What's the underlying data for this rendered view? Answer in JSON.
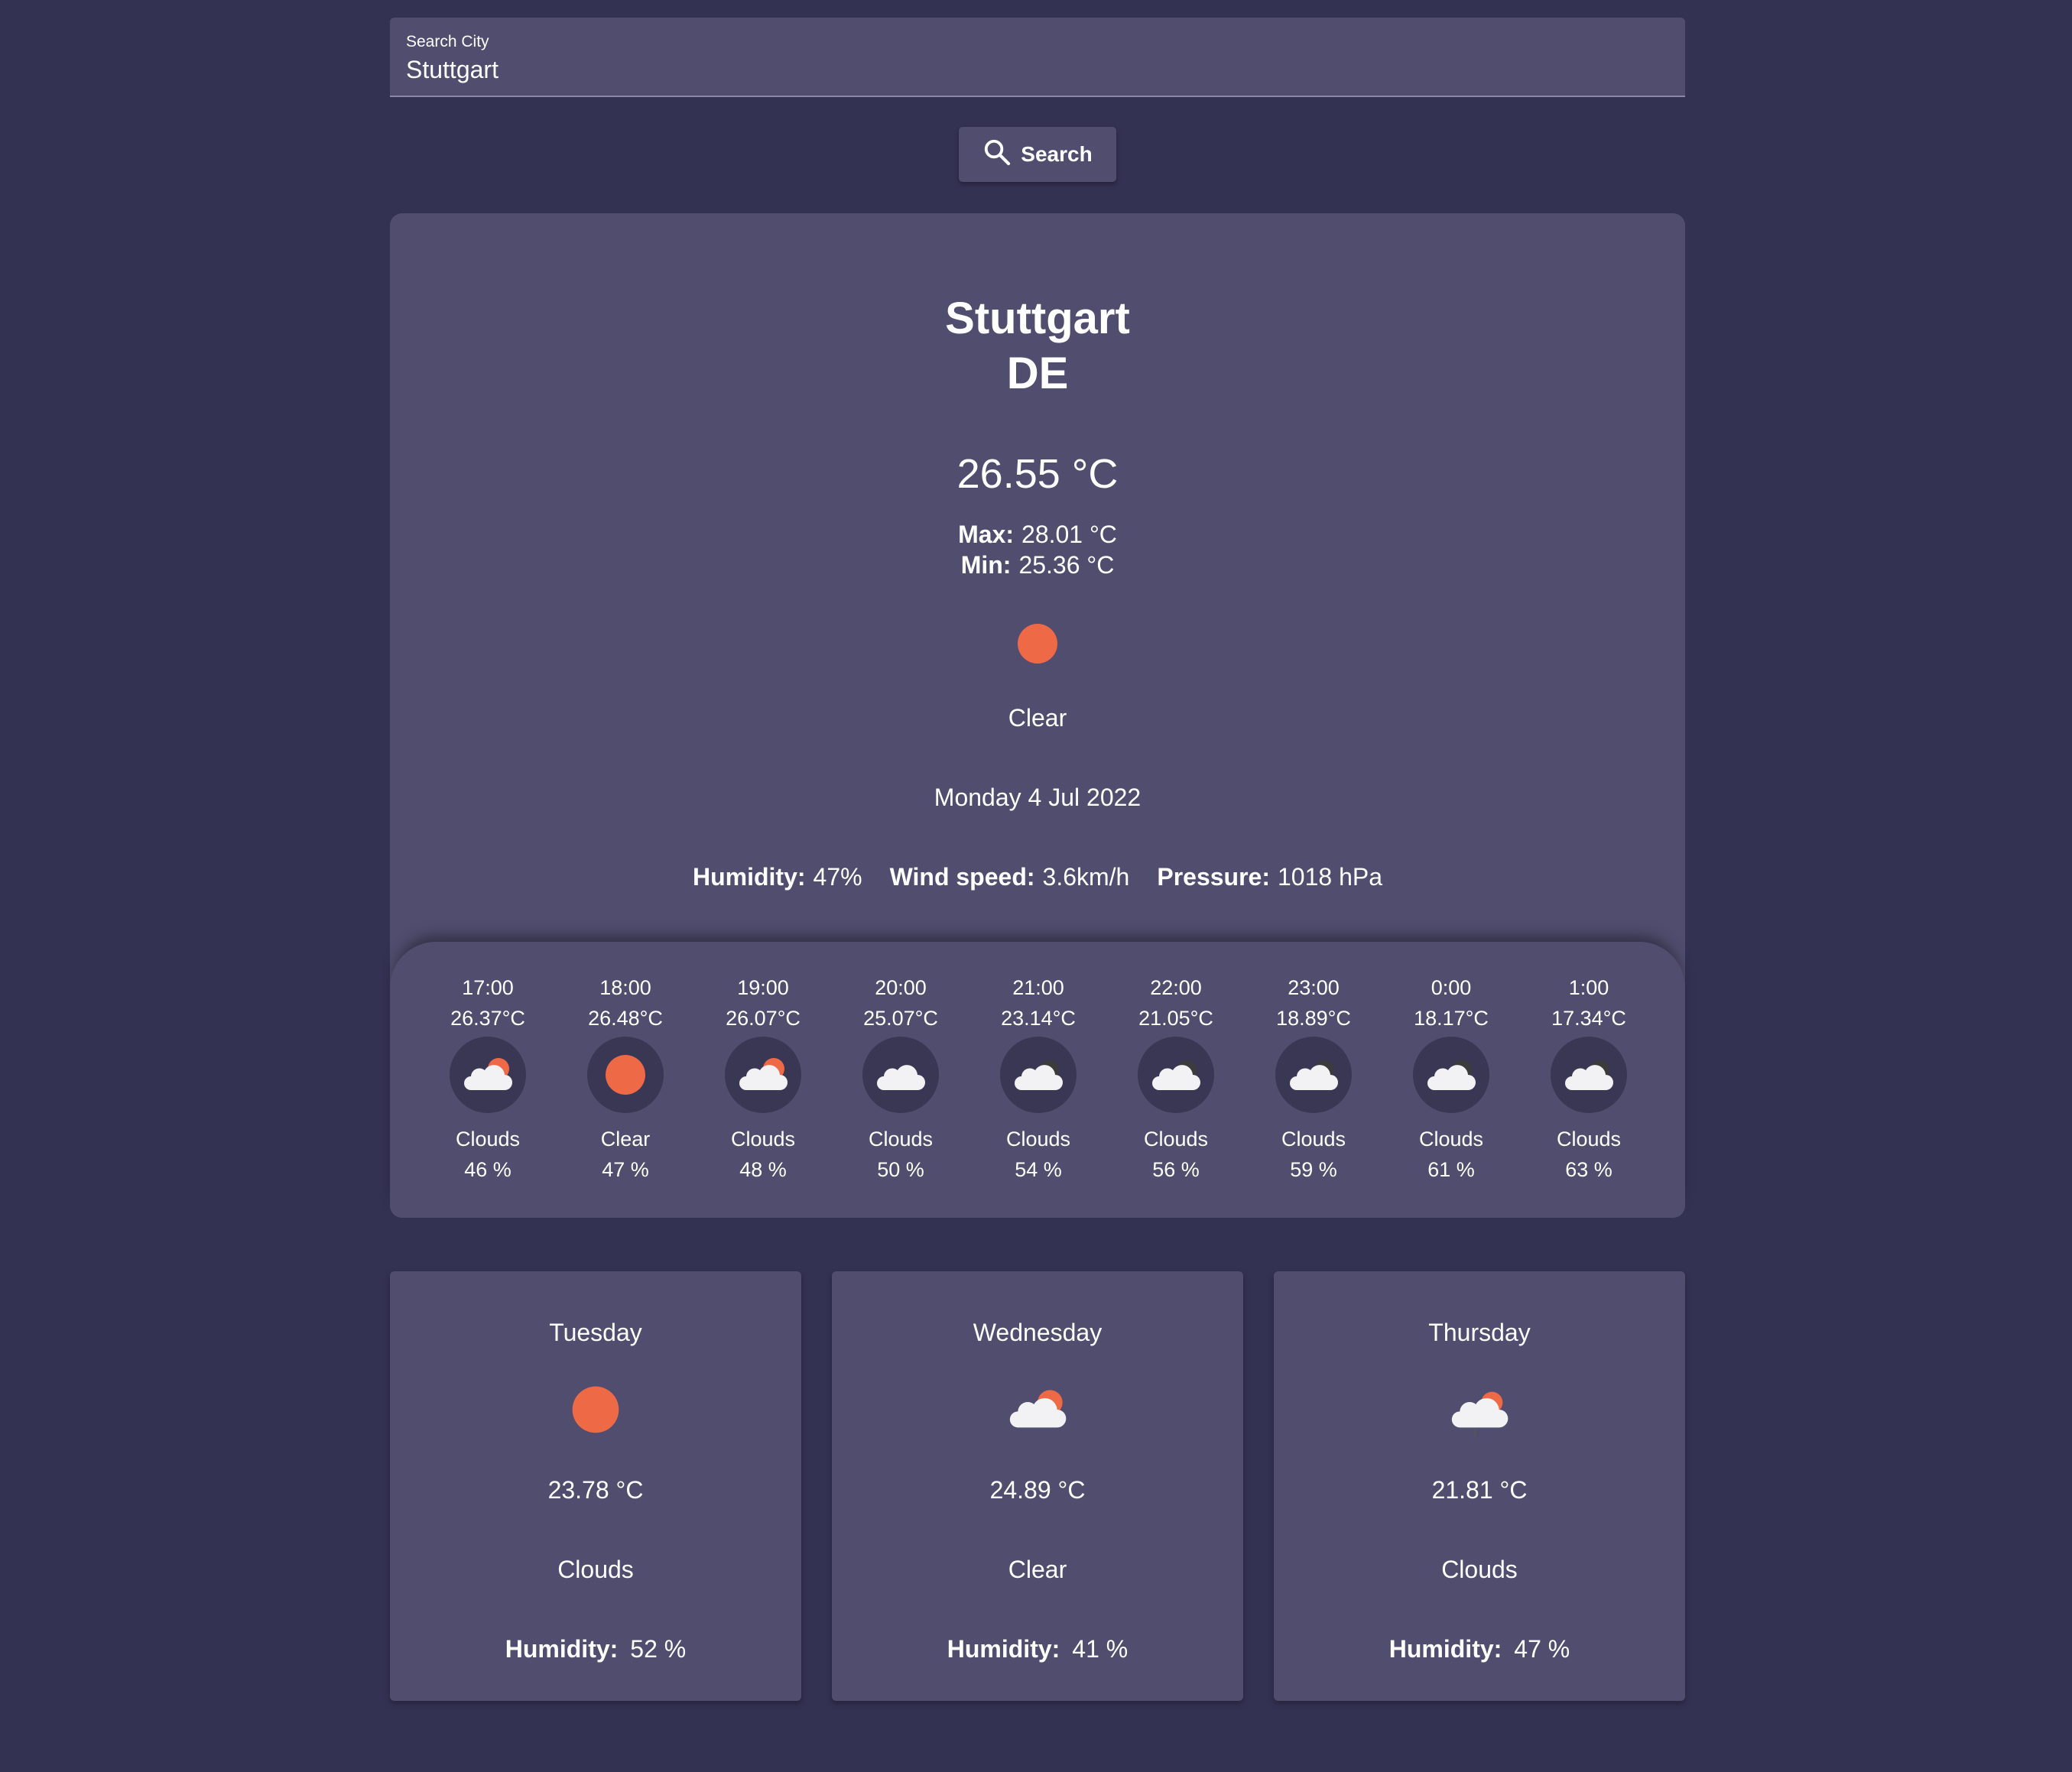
{
  "search": {
    "label": "Search City",
    "value": "Stuttgart",
    "button_label": "Search",
    "button_icon": "search-icon"
  },
  "current": {
    "city": "Stuttgart",
    "country": "DE",
    "temp": "26.55 °C",
    "max_label": "Max:",
    "max_value": "28.01 °C",
    "min_label": "Min:",
    "min_value": "25.36 °C",
    "icon": "sun-icon",
    "condition": "Clear",
    "date": "Monday 4 Jul 2022",
    "humidity_label": "Humidity:",
    "humidity_value": "47%",
    "wind_label": "Wind speed:",
    "wind_value": "3.6km/h",
    "pressure_label": "Pressure:",
    "pressure_value": "1018 hPa"
  },
  "hourly": [
    {
      "time": "17:00",
      "temp": "26.37°C",
      "icon": "cloud-sun-icon",
      "condition": "Clouds",
      "humidity": "46 %"
    },
    {
      "time": "18:00",
      "temp": "26.48°C",
      "icon": "sun-icon",
      "condition": "Clear",
      "humidity": "47 %"
    },
    {
      "time": "19:00",
      "temp": "26.07°C",
      "icon": "cloud-sun-icon",
      "condition": "Clouds",
      "humidity": "48 %"
    },
    {
      "time": "20:00",
      "temp": "25.07°C",
      "icon": "cloud-icon",
      "condition": "Clouds",
      "humidity": "50 %"
    },
    {
      "time": "21:00",
      "temp": "23.14°C",
      "icon": "cloud-moon-icon",
      "condition": "Clouds",
      "humidity": "54 %"
    },
    {
      "time": "22:00",
      "temp": "21.05°C",
      "icon": "cloud-moon-icon",
      "condition": "Clouds",
      "humidity": "56 %"
    },
    {
      "time": "23:00",
      "temp": "18.89°C",
      "icon": "cloud-moon-icon",
      "condition": "Clouds",
      "humidity": "59 %"
    },
    {
      "time": "0:00",
      "temp": "18.17°C",
      "icon": "cloud-moon-icon",
      "condition": "Clouds",
      "humidity": "61 %"
    },
    {
      "time": "1:00",
      "temp": "17.34°C",
      "icon": "cloud-moon-icon",
      "condition": "Clouds",
      "humidity": "63 %"
    }
  ],
  "daily": [
    {
      "day": "Tuesday",
      "icon": "sun-icon",
      "temp": "23.78 °C",
      "condition": "Clouds",
      "humidity_label": "Humidity:",
      "humidity": "52 %"
    },
    {
      "day": "Wednesday",
      "icon": "cloud-sun-icon",
      "temp": "24.89 °C",
      "condition": "Clear",
      "humidity_label": "Humidity:",
      "humidity": "41 %"
    },
    {
      "day": "Thursday",
      "icon": "cloud-sun-rain-icon",
      "temp": "21.81 °C",
      "condition": "Clouds",
      "humidity_label": "Humidity:",
      "humidity": "47 %"
    }
  ],
  "colors": {
    "background": "#343253",
    "card": "#514d6f",
    "icon_circle": "#3a3754",
    "sun": "#ee6a46",
    "cloud": "#f2f2f4"
  }
}
